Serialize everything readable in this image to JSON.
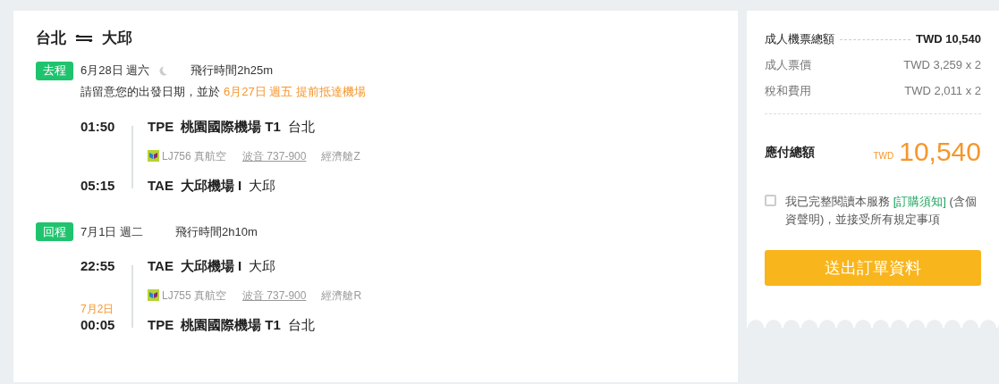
{
  "route": {
    "origin": "台北",
    "destination": "大邱"
  },
  "legs": [
    {
      "tag": "去程",
      "date": "6月28日 週六",
      "night": true,
      "duration": "飛行時間2h25m",
      "notice": {
        "text": "請留意您的出發日期，並於",
        "highlight": "6月27日 週五 提前抵達機場"
      },
      "departure": {
        "time": "01:50",
        "code": "TPE",
        "airport": "桃園國際機場 T1",
        "city": "台北"
      },
      "flight": {
        "number": "LJ756 真航空",
        "aircraft": "波音 737-900",
        "cabin": "經濟艙Z"
      },
      "arrival": {
        "time": "05:15",
        "code": "TAE",
        "airport": "大邱機場 I",
        "city": "大邱"
      }
    },
    {
      "tag": "回程",
      "date": "7月1日 週二",
      "night": false,
      "duration": "飛行時間2h10m",
      "departure": {
        "time": "22:55",
        "code": "TAE",
        "airport": "大邱機場 I",
        "city": "大邱"
      },
      "flight": {
        "number": "LJ755 真航空",
        "aircraft": "波音 737-900",
        "cabin": "經濟艙R"
      },
      "arrival": {
        "date": "7月2日",
        "time": "00:05",
        "code": "TPE",
        "airport": "桃園國際機場 T1",
        "city": "台北"
      }
    }
  ],
  "summary": {
    "total_label": "成人機票總額",
    "total_value": "TWD 10,540",
    "items": [
      {
        "label": "成人票價",
        "value": "TWD 3,259 x 2"
      },
      {
        "label": "稅和費用",
        "value": "TWD 2,011 x 2"
      }
    ],
    "due_label": "應付總額",
    "due_currency": "TWD",
    "due_amount": "10,540"
  },
  "agreement": {
    "checked": false,
    "before": "我已完整閱讀本服務",
    "link": "[訂購須知]",
    "after": "(含個資聲明)，並接受所有規定事項"
  },
  "submit": "送出訂單資料"
}
